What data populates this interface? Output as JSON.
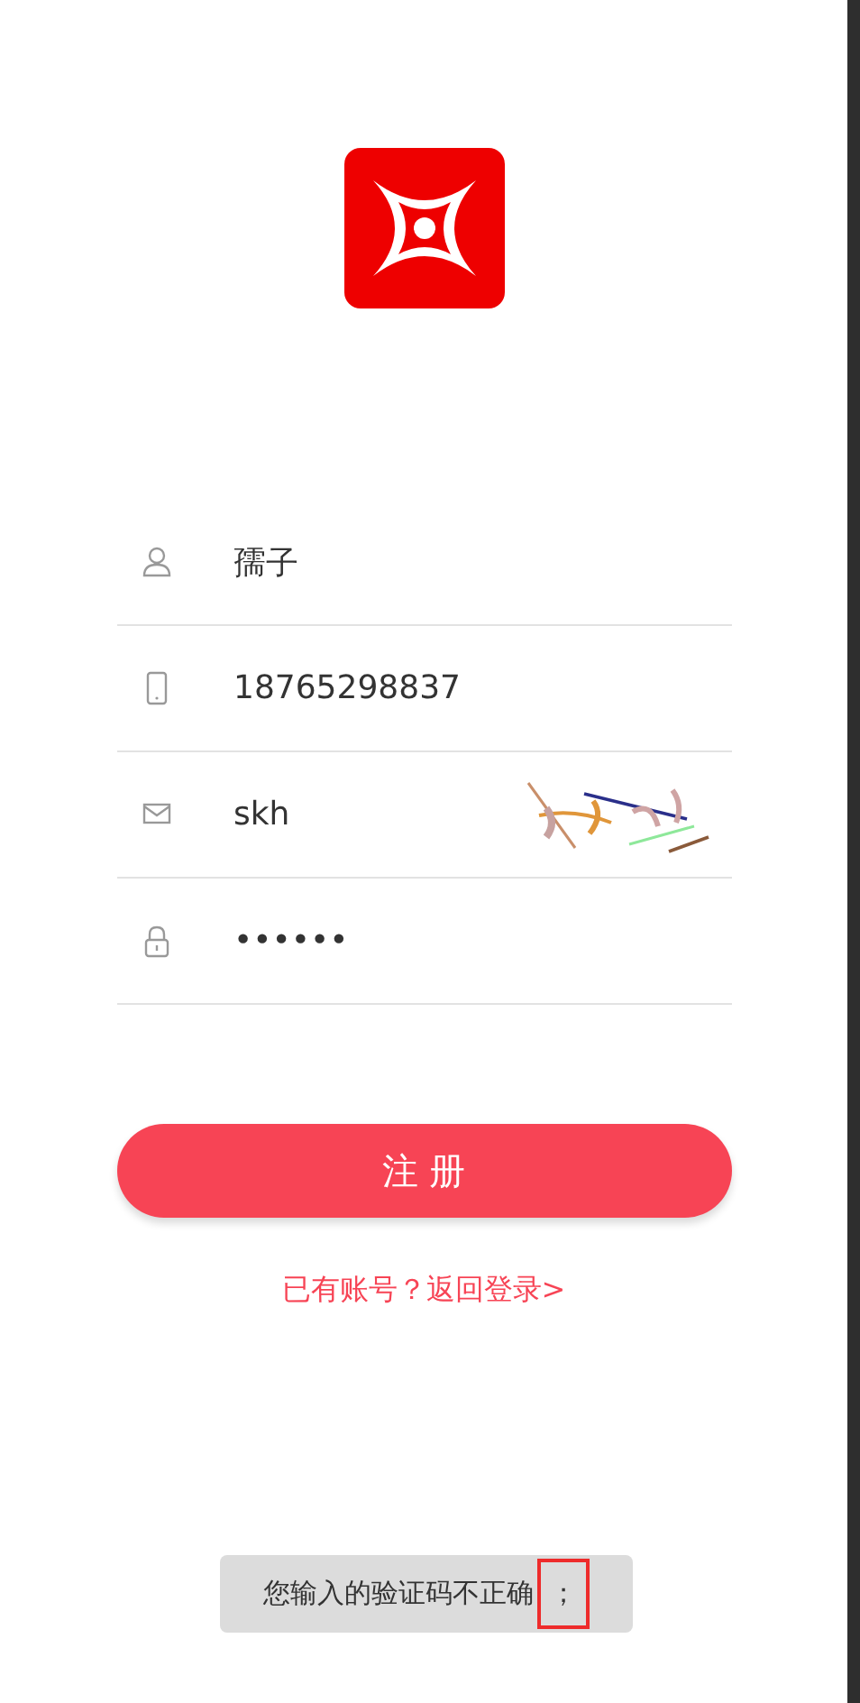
{
  "form": {
    "fields": [
      {
        "kind": "user",
        "value": "孺子"
      },
      {
        "kind": "phone",
        "value": "18765298837"
      },
      {
        "kind": "mail",
        "value": "skh"
      },
      {
        "kind": "lock",
        "value": "••••••"
      }
    ]
  },
  "register_button": "注 册",
  "login_link": "已有账号？返回登录>",
  "toast": {
    "message": "您输入的验证码不正确",
    "marked": "；"
  }
}
